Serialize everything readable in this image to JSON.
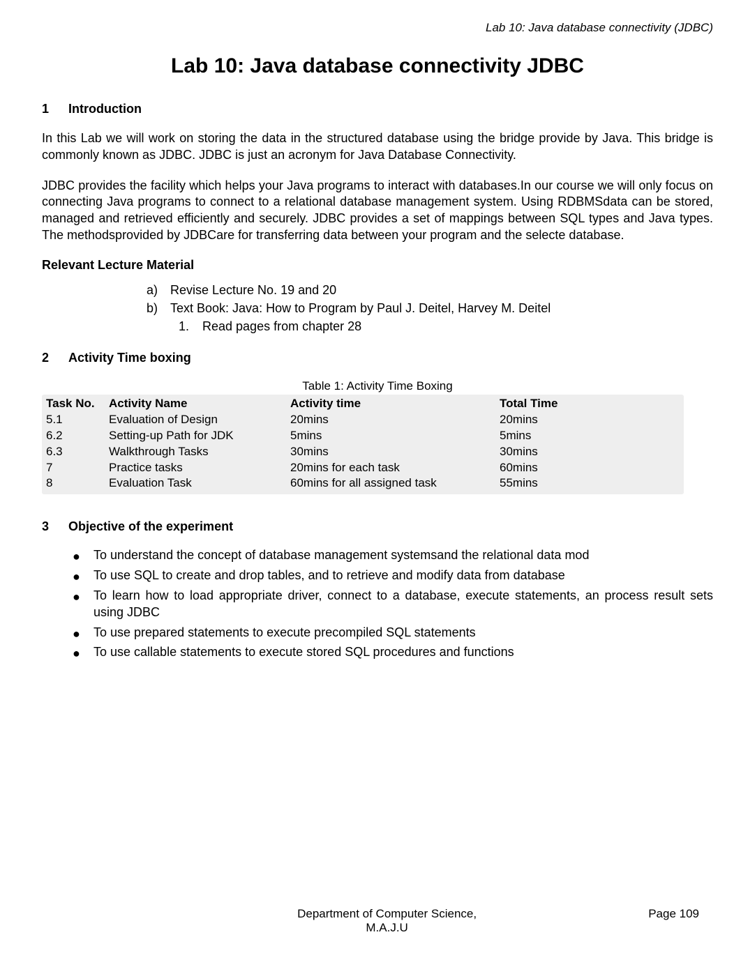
{
  "header": {
    "running_title": "Lab 10: Java database connectivity (JDBC)"
  },
  "title": "Lab 10: Java database connectivity JDBC",
  "sections": {
    "intro": {
      "num": "1",
      "heading": "Introduction",
      "para1": "In this Lab we will work on storing the data in the structured database using the bridge provide by Java. This bridge is commonly known as JDBC. JDBC is just an acronym for Java Database Connectivity.",
      "para2": "JDBC provides the facility which helps your Java programs to interact with databases.In our course we will only focus on connecting Java programs to connect to a relational database management system. Using RDBMSdata can be stored, managed and retrieved efficiently and securely. JDBC provides a set of mappings between SQL types and Java types. The methodsprovided by JDBCare for transferring data between your program and the selecte database."
    },
    "lecture": {
      "heading": "Relevant Lecture Material",
      "items": {
        "a_marker": "a)",
        "a_text": "Revise Lecture No. 19 and 20",
        "b_marker": "b)",
        "b_text": "Text Book: Java: How to Program by Paul J. Deitel, Harvey M. Deitel",
        "b1_marker": "1.",
        "b1_text": "Read pages from chapter 28"
      }
    },
    "timebox": {
      "num": "2",
      "heading": "Activity Time boxing",
      "caption": "Table 1: Activity Time Boxing",
      "headers": {
        "c1": "Task No.",
        "c2": "Activity Name",
        "c3": "Activity time",
        "c4": "Total Time"
      },
      "rows": [
        {
          "c1": "5.1",
          "c2": "Evaluation of Design",
          "c3": "20mins",
          "c4": "20mins"
        },
        {
          "c1": "6.2",
          "c2": "Setting-up Path for JDK",
          "c3": "5mins",
          "c4": "5mins"
        },
        {
          "c1": "6.3",
          "c2": "Walkthrough Tasks",
          "c3": "30mins",
          "c4": "30mins"
        },
        {
          "c1": "7",
          "c2": "Practice tasks",
          "c3": "20mins for each task",
          "c4": "60mins"
        },
        {
          "c1": "8",
          "c2": "Evaluation Task",
          "c3": "60mins for all assigned task",
          "c4": "55mins"
        }
      ]
    },
    "objective": {
      "num": "3",
      "heading": "Objective of the experiment",
      "bullets": [
        "To understand the concept of database management systemsand the relational data mod",
        "To use SQL to create and drop tables, and to retrieve and modify data from database",
        "To learn how to load appropriate driver, connect to a database, execute statements, an process result sets using JDBC",
        "To use prepared statements to execute precompiled SQL statements",
        "To use callable statements to execute stored SQL procedures and functions"
      ]
    }
  },
  "footer": {
    "dept_line1": "Department of Computer Science,",
    "dept_line2": "M.A.J.U",
    "page": "Page 109"
  }
}
